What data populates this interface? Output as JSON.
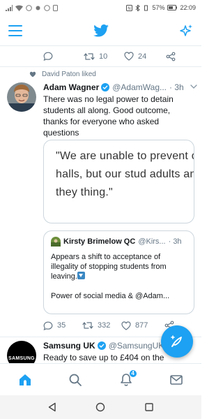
{
  "status_bar": {
    "time": "22:09",
    "battery": "57%"
  },
  "header": {
    "menu_icon": "hamburger-menu-icon",
    "logo_icon": "twitter-bird-icon",
    "sparkle_icon": "sparkle-icon"
  },
  "previous_tweet": {
    "retweets": "10",
    "likes": "24"
  },
  "tweet": {
    "social_context": "David Paton liked",
    "name": "Adam Wagner",
    "handle": "@AdamWag...",
    "time": "· 3h",
    "text": "There was no legal power to detain students all along. Good outcome, thanks for everyone who asked questions",
    "image_text": "\"We are unable to prevent ou leaving the halls, but our stud adults and we trust that they thing.\"",
    "replies": "35",
    "retweets": "332",
    "likes": "877",
    "quoted": {
      "name": "Kirsty Brimelow QC",
      "handle": "@Kirs...",
      "time": "· 3h",
      "text": "Appears a shift to acceptance of illegality of stopping students from leaving.",
      "text2": "Power of social media & @Adam..."
    }
  },
  "next_tweet": {
    "name": "Samsung UK",
    "handle": "@SamsungUK",
    "avatar_text": "SAMSUNG",
    "text": "Ready to save up to £404 on the"
  },
  "bottom_nav": {
    "notifications_badge": "4"
  },
  "colors": {
    "accent": "#1da1f2",
    "text": "#14171a",
    "muted": "#657786"
  }
}
